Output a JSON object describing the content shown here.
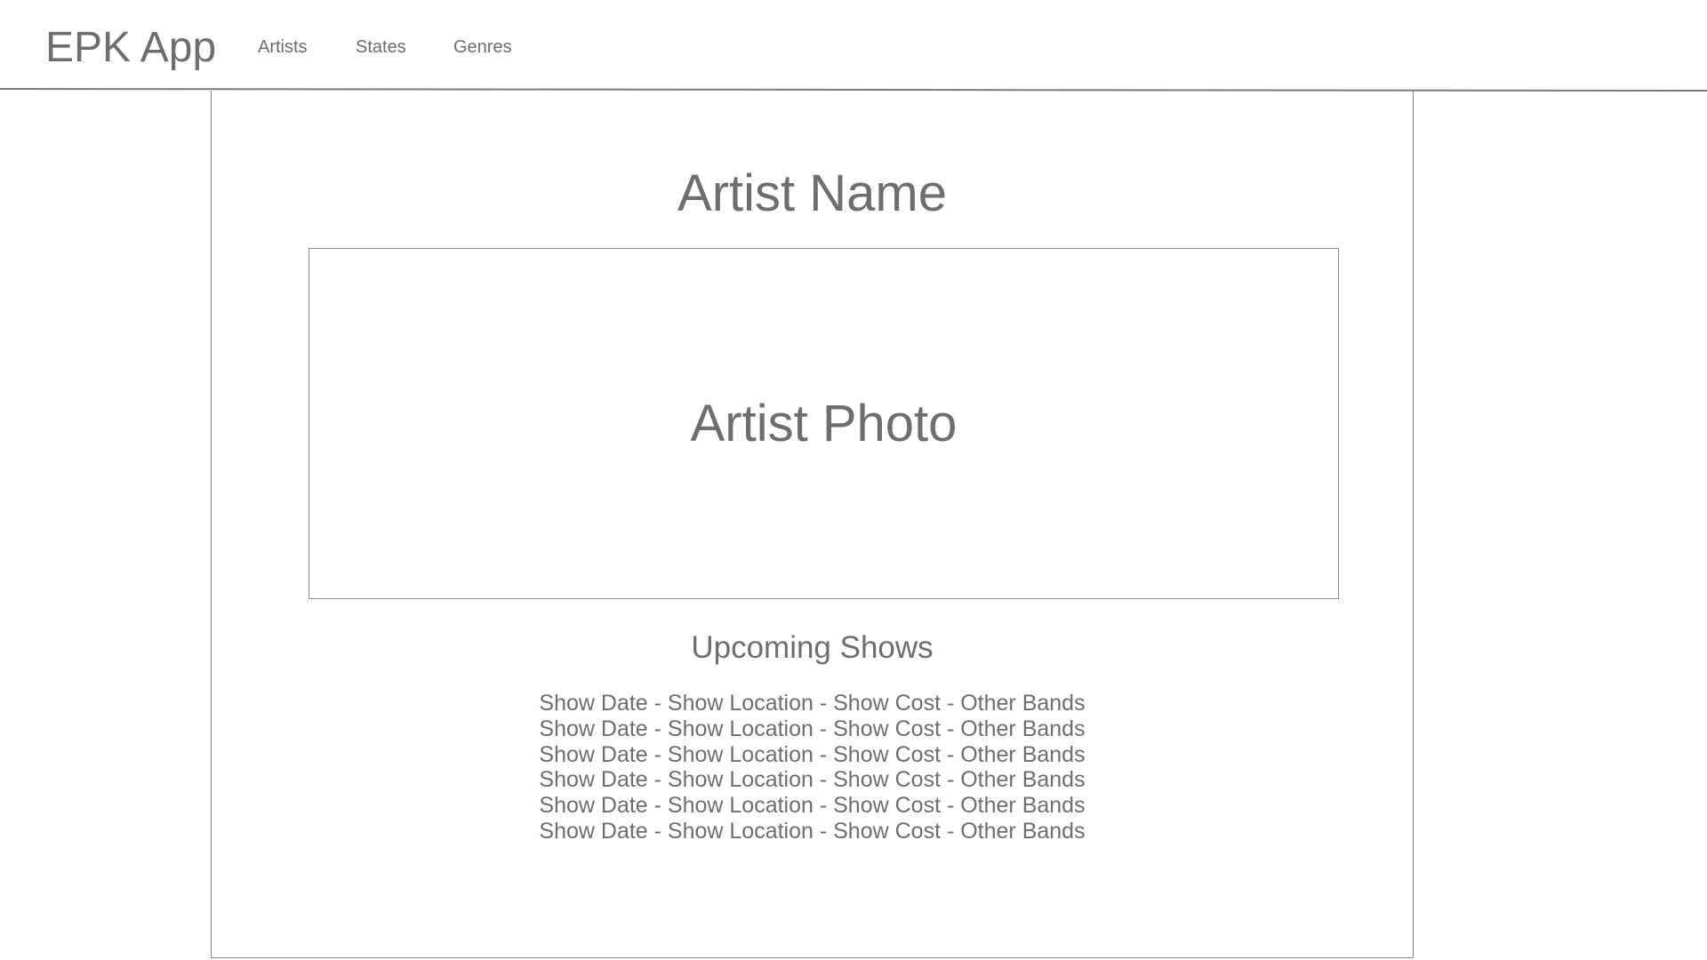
{
  "header": {
    "brand": "EPK App",
    "nav": {
      "artists": "Artists",
      "states": "States",
      "genres": "Genres"
    }
  },
  "main": {
    "artist_name": "Artist Name",
    "photo_label": "Artist Photo",
    "shows_heading": "Upcoming Shows",
    "shows": [
      "Show Date - Show Location - Show Cost - Other Bands",
      "Show Date - Show Location - Show Cost - Other Bands",
      "Show Date - Show Location - Show Cost - Other Bands",
      "Show Date - Show Location - Show Cost - Other Bands",
      "Show Date - Show Location - Show Cost - Other Bands",
      "Show Date - Show Location - Show Cost - Other Bands"
    ]
  },
  "colors": {
    "text": "#6e6e6e",
    "border": "#8a8a8a",
    "background": "#ffffff"
  }
}
